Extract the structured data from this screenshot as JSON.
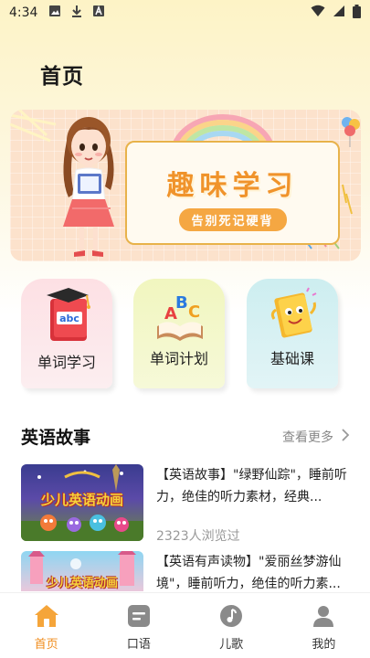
{
  "status_bar": {
    "time": "4:34"
  },
  "header": {
    "title": "首页"
  },
  "banner": {
    "title": "趣味学习",
    "subtitle": "告别死记硬背"
  },
  "tiles": [
    {
      "label": "单词学习",
      "icon": "abc-book-icon",
      "color": "#fde0e4"
    },
    {
      "label": "单词计划",
      "icon": "abc-open-book-icon",
      "color": "#f1f6bf"
    },
    {
      "label": "基础课",
      "icon": "book-character-icon",
      "color": "#cdeef0"
    }
  ],
  "stories": {
    "section_title": "英语故事",
    "more_label": "查看更多",
    "items": [
      {
        "text": "【英语故事】\"绿野仙踪\"，睡前听力，绝佳的听力素材，经典...",
        "thumb_text": "少儿英语动画",
        "views": "2323人浏览过"
      },
      {
        "text": "【英语有声读物】\"爱丽丝梦游仙境\"，睡前听力，绝佳的听力素...",
        "thumb_text": "少儿英语动画"
      }
    ]
  },
  "tabbar": {
    "items": [
      {
        "label": "首页",
        "icon": "home-icon",
        "active": true
      },
      {
        "label": "口语",
        "icon": "speech-icon"
      },
      {
        "label": "儿歌",
        "icon": "music-note-icon"
      },
      {
        "label": "我的",
        "icon": "person-icon"
      }
    ],
    "active_color": "#f08c1c"
  }
}
